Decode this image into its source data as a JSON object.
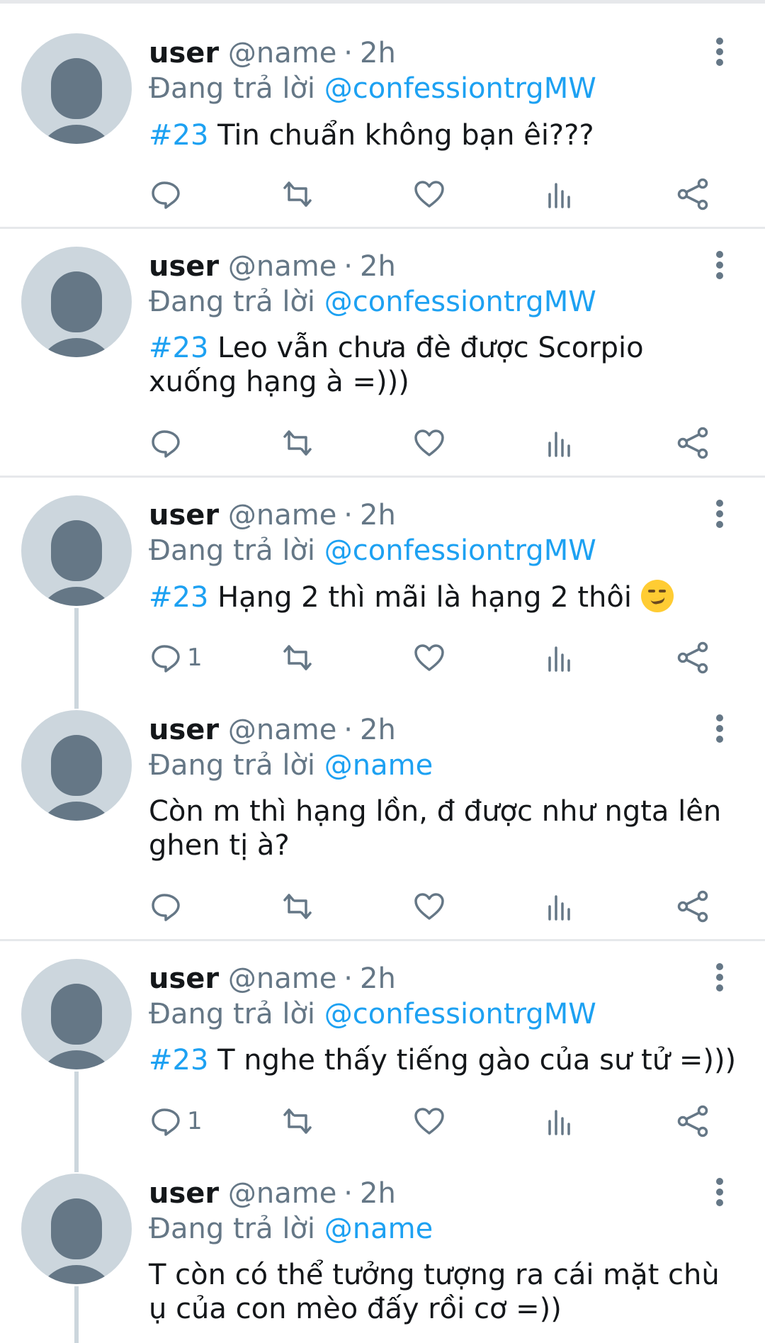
{
  "tweets": [
    {
      "username": "user",
      "handle": "@name",
      "time": "2h",
      "reply_prefix": "Đang trả lời",
      "reply_to": "@confessiontrgMW",
      "hashtag": "#23",
      "text": " Tin chuẩn không bạn êi???",
      "reply_count": ""
    },
    {
      "username": "user",
      "handle": "@name",
      "time": "2h",
      "reply_prefix": "Đang trả lời",
      "reply_to": "@confessiontrgMW",
      "hashtag": "#23",
      "text": " Leo vẫn chưa đè được Scorpio xuống hạng à =)))",
      "reply_count": ""
    },
    {
      "username": "user",
      "handle": "@name",
      "time": "2h",
      "reply_prefix": "Đang trả lời",
      "reply_to": "@confessiontrgMW",
      "hashtag": "#23",
      "text": " Hạng 2 thì mãi là hạng 2 thôi ",
      "reply_count": "1"
    },
    {
      "username": "user",
      "handle": "@name",
      "time": "2h",
      "reply_prefix": "Đang trả lời",
      "reply_to": "@name",
      "hashtag": "",
      "text": "Còn m thì hạng lồn, đ được như ngta lên ghen tị à?",
      "reply_count": ""
    },
    {
      "username": "user",
      "handle": "@name",
      "time": "2h",
      "reply_prefix": "Đang trả lời",
      "reply_to": "@confessiontrgMW",
      "hashtag": "#23",
      "text": " T nghe thấy tiếng gào của sư tử =)))",
      "reply_count": "1"
    },
    {
      "username": "user",
      "handle": "@name",
      "time": "2h",
      "reply_prefix": "Đang trả lời",
      "reply_to": "@name",
      "hashtag": "",
      "text": "T còn có thể tưởng tượng ra cái mặt chù ụ của con mèo đấy rồi cơ =))",
      "reply_count": ""
    }
  ],
  "separator": "·",
  "icons": {
    "reply": "reply-icon",
    "retweet": "retweet-icon",
    "like": "heart-icon",
    "analytics": "analytics-icon",
    "share": "share-icon",
    "more": "more-vertical-icon",
    "emoji": "smirking-face-emoji"
  },
  "colors": {
    "accent": "#1da1f2",
    "secondary_text": "#657786",
    "avatar_bg": "#ccd6dd",
    "divider": "#e6e8eb"
  }
}
